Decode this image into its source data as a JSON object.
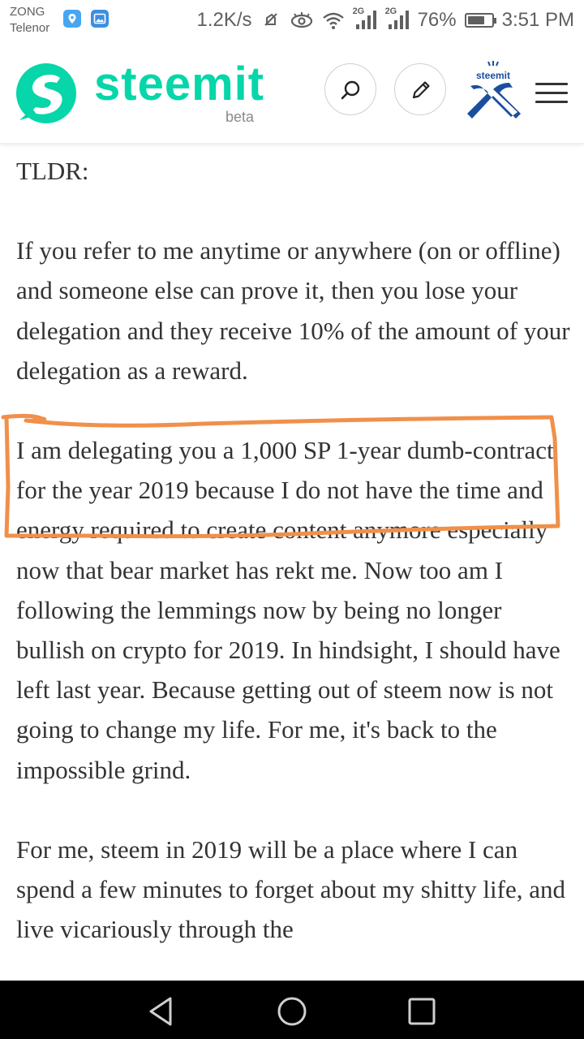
{
  "status_bar": {
    "carrier_1": "ZONG",
    "carrier_2": "Telenor",
    "net_speed": "1.2K/s",
    "net_tag_1": "2G",
    "net_tag_2": "2G",
    "battery_percent": "76%",
    "battery_level": 0.76,
    "time": "3:51 PM"
  },
  "header": {
    "logo_text": "steemit",
    "logo_badge": "beta",
    "avatar_label": "steemit",
    "colors": {
      "brand": "#06d6a9",
      "avatar_blue": "#1a4e9e"
    },
    "icons": [
      "search-icon",
      "pencil-icon",
      "menu-icon"
    ]
  },
  "article": {
    "paragraphs": [
      "TLDR:",
      "If you refer to me anytime or anywhere (on or offline) and someone else can prove it, then you lose your delegation and they receive 10% of the amount of your delegation as a reward.",
      "I am delegating you a 1,000 SP 1-year dumb-contract for the year 2019 because I do not have the time and energy required to create content anymore especially now that bear market has rekt me. Now too am I following the lemmings now by being no longer bullish on crypto for 2019. In hindsight, I should have left last year. Because getting out of steem now is not going to change my life. For me, it's back to the impossible grind.",
      "For me, steem in 2019 will be a place where I can spend a few minutes to forget about my shitty life, and live vicariously through the"
    ],
    "annotation_color": "#f0904a"
  },
  "nav_bar": {
    "icons": [
      "back-icon",
      "home-icon",
      "recents-icon"
    ]
  }
}
